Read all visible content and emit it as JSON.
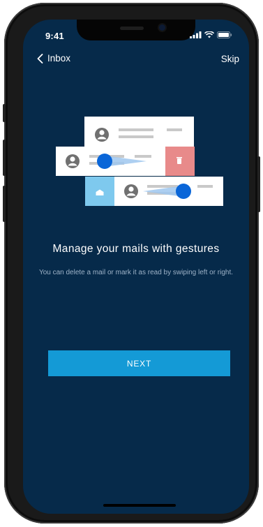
{
  "status_bar": {
    "time": "9:41",
    "icons": [
      "signal-icon",
      "wifi-icon",
      "battery-icon"
    ]
  },
  "nav": {
    "back_label": "Inbox",
    "back_icon": "chevron-left-icon",
    "skip_label": "Skip"
  },
  "illustration": {
    "description_icons": [
      "avatar-icon",
      "trash-icon",
      "mail-read-icon",
      "swipe-gesture-icon"
    ],
    "colors": {
      "card": "#ffffff",
      "delete_action": "#e88a8a",
      "read_action": "#7ec9ee",
      "gesture_dot": "#0a66d8"
    }
  },
  "onboarding": {
    "title": "Manage your mails with gestures",
    "description": "You can delete a mail or mark it as read by swiping left or right.",
    "next_label": "NEXT"
  },
  "colors": {
    "background": "#062a4a",
    "accent": "#149ad6",
    "text_secondary": "#9db2c7"
  }
}
